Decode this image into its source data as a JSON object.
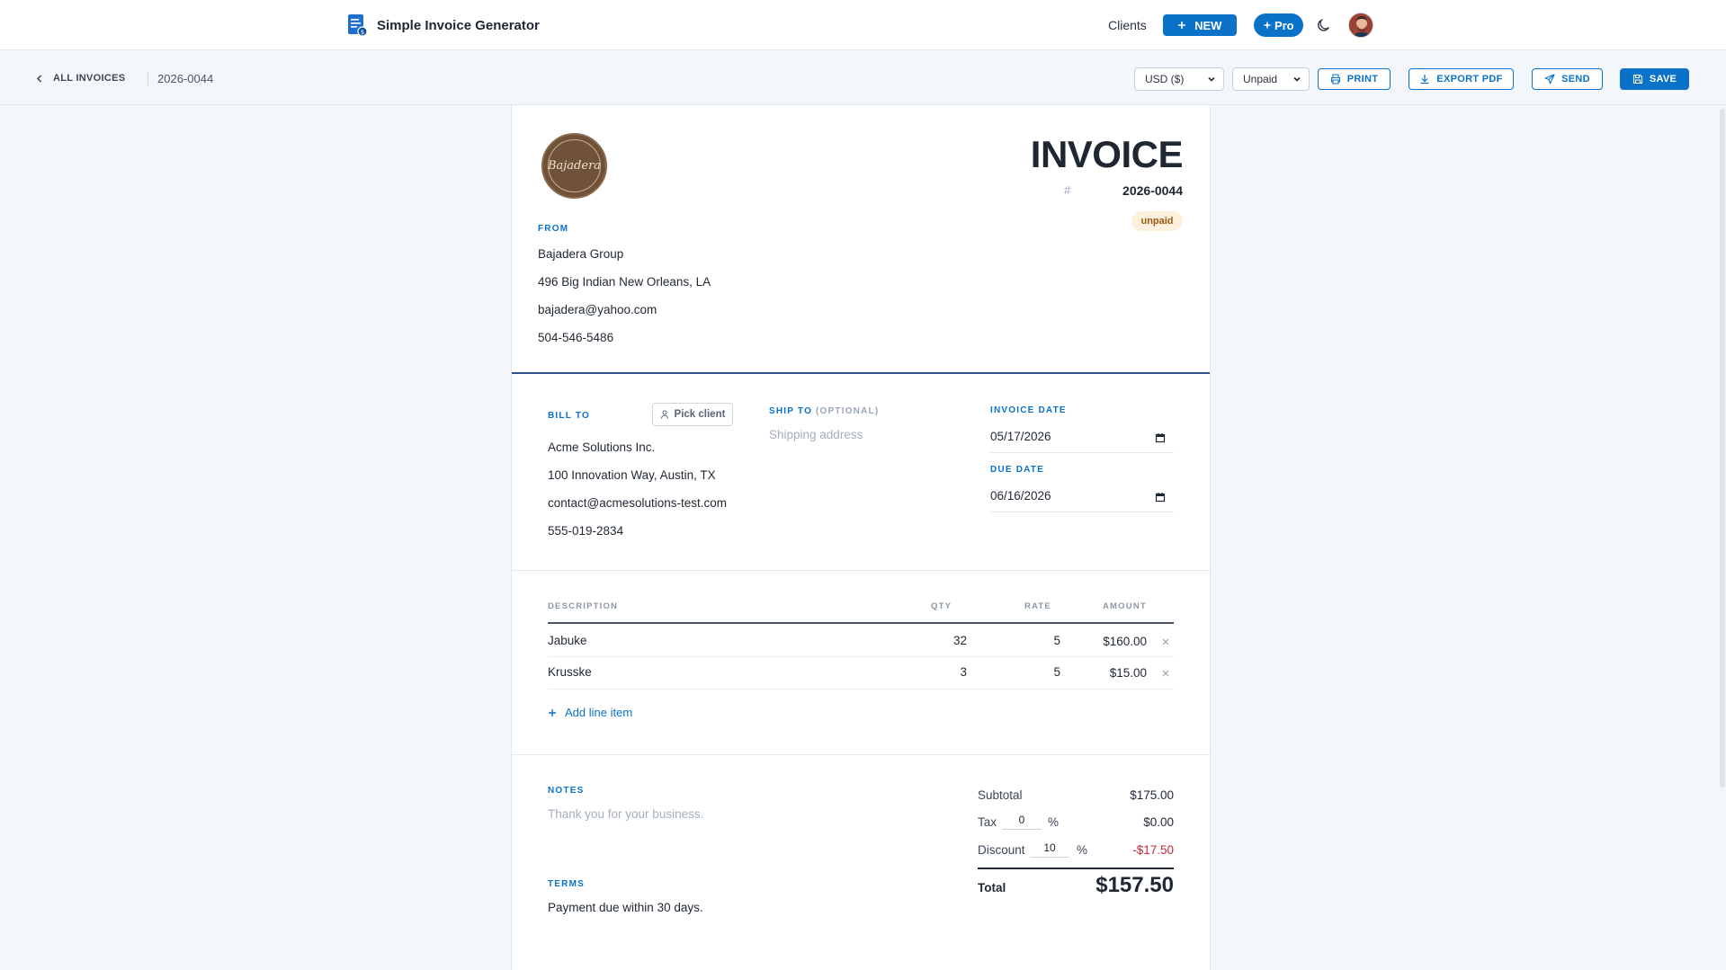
{
  "app": {
    "name": "Simple Invoice Generator"
  },
  "nav": {
    "clients": "Clients",
    "new": "NEW",
    "pro": "Pro"
  },
  "toolbar": {
    "back": "ALL INVOICES",
    "invoice_number": "2026-0044",
    "currency": "USD ($)",
    "status": "Unpaid",
    "print": "PRINT",
    "export_pdf": "EXPORT PDF",
    "send": "SEND",
    "save": "SAVE"
  },
  "invoice": {
    "logo_text": "Bajadera",
    "title": "INVOICE",
    "hash": "#",
    "number": "2026-0044",
    "status_badge": "unpaid",
    "from": {
      "label": "FROM",
      "name": "Bajadera Group",
      "address": "496 Big Indian New Orleans, LA",
      "email": "bajadera@yahoo.com",
      "phone": "504-546-5486"
    },
    "bill_to": {
      "label": "BILL TO",
      "pick_client": "Pick client",
      "name": "Acme Solutions Inc.",
      "address": "100 Innovation Way, Austin, TX",
      "email": "contact@acmesolutions-test.com",
      "phone": "555-019-2834"
    },
    "ship_to": {
      "label": "SHIP TO",
      "optional": "(OPTIONAL)",
      "placeholder": "Shipping address"
    },
    "invoice_date": {
      "label": "INVOICE DATE",
      "value": "05/17/2026"
    },
    "due_date": {
      "label": "DUE DATE",
      "value": "06/16/2026"
    },
    "items": {
      "headers": {
        "description": "DESCRIPTION",
        "qty": "QTY",
        "rate": "RATE",
        "amount": "AMOUNT"
      },
      "rows": [
        {
          "description": "Jabuke",
          "qty": "32",
          "rate": "5",
          "amount": "$160.00"
        },
        {
          "description": "Krusske",
          "qty": "3",
          "rate": "5",
          "amount": "$15.00"
        }
      ],
      "add_line": "Add line item"
    },
    "notes": {
      "label": "NOTES",
      "placeholder": "Thank you for your business."
    },
    "terms": {
      "label": "TERMS",
      "value": "Payment due within 30 days."
    },
    "summary": {
      "subtotal_label": "Subtotal",
      "subtotal": "$175.00",
      "tax_label": "Tax",
      "tax_rate": "0",
      "percent": "%",
      "tax": "$0.00",
      "discount_label": "Discount",
      "discount_rate": "10",
      "discount": "-$17.50",
      "total_label": "Total",
      "total": "$157.50"
    }
  },
  "colors": {
    "accent": "#0b72c9",
    "negative": "#c8283a",
    "badge_bg": "#fdf0dc",
    "badge_text": "#9b5a12"
  },
  "icons": [
    "document-icon",
    "plus-icon",
    "sparkle-icon",
    "moon-icon",
    "chevron-left-icon",
    "printer-icon",
    "download-icon",
    "send-icon",
    "save-icon",
    "user-icon",
    "calendar-icon",
    "close-icon"
  ]
}
